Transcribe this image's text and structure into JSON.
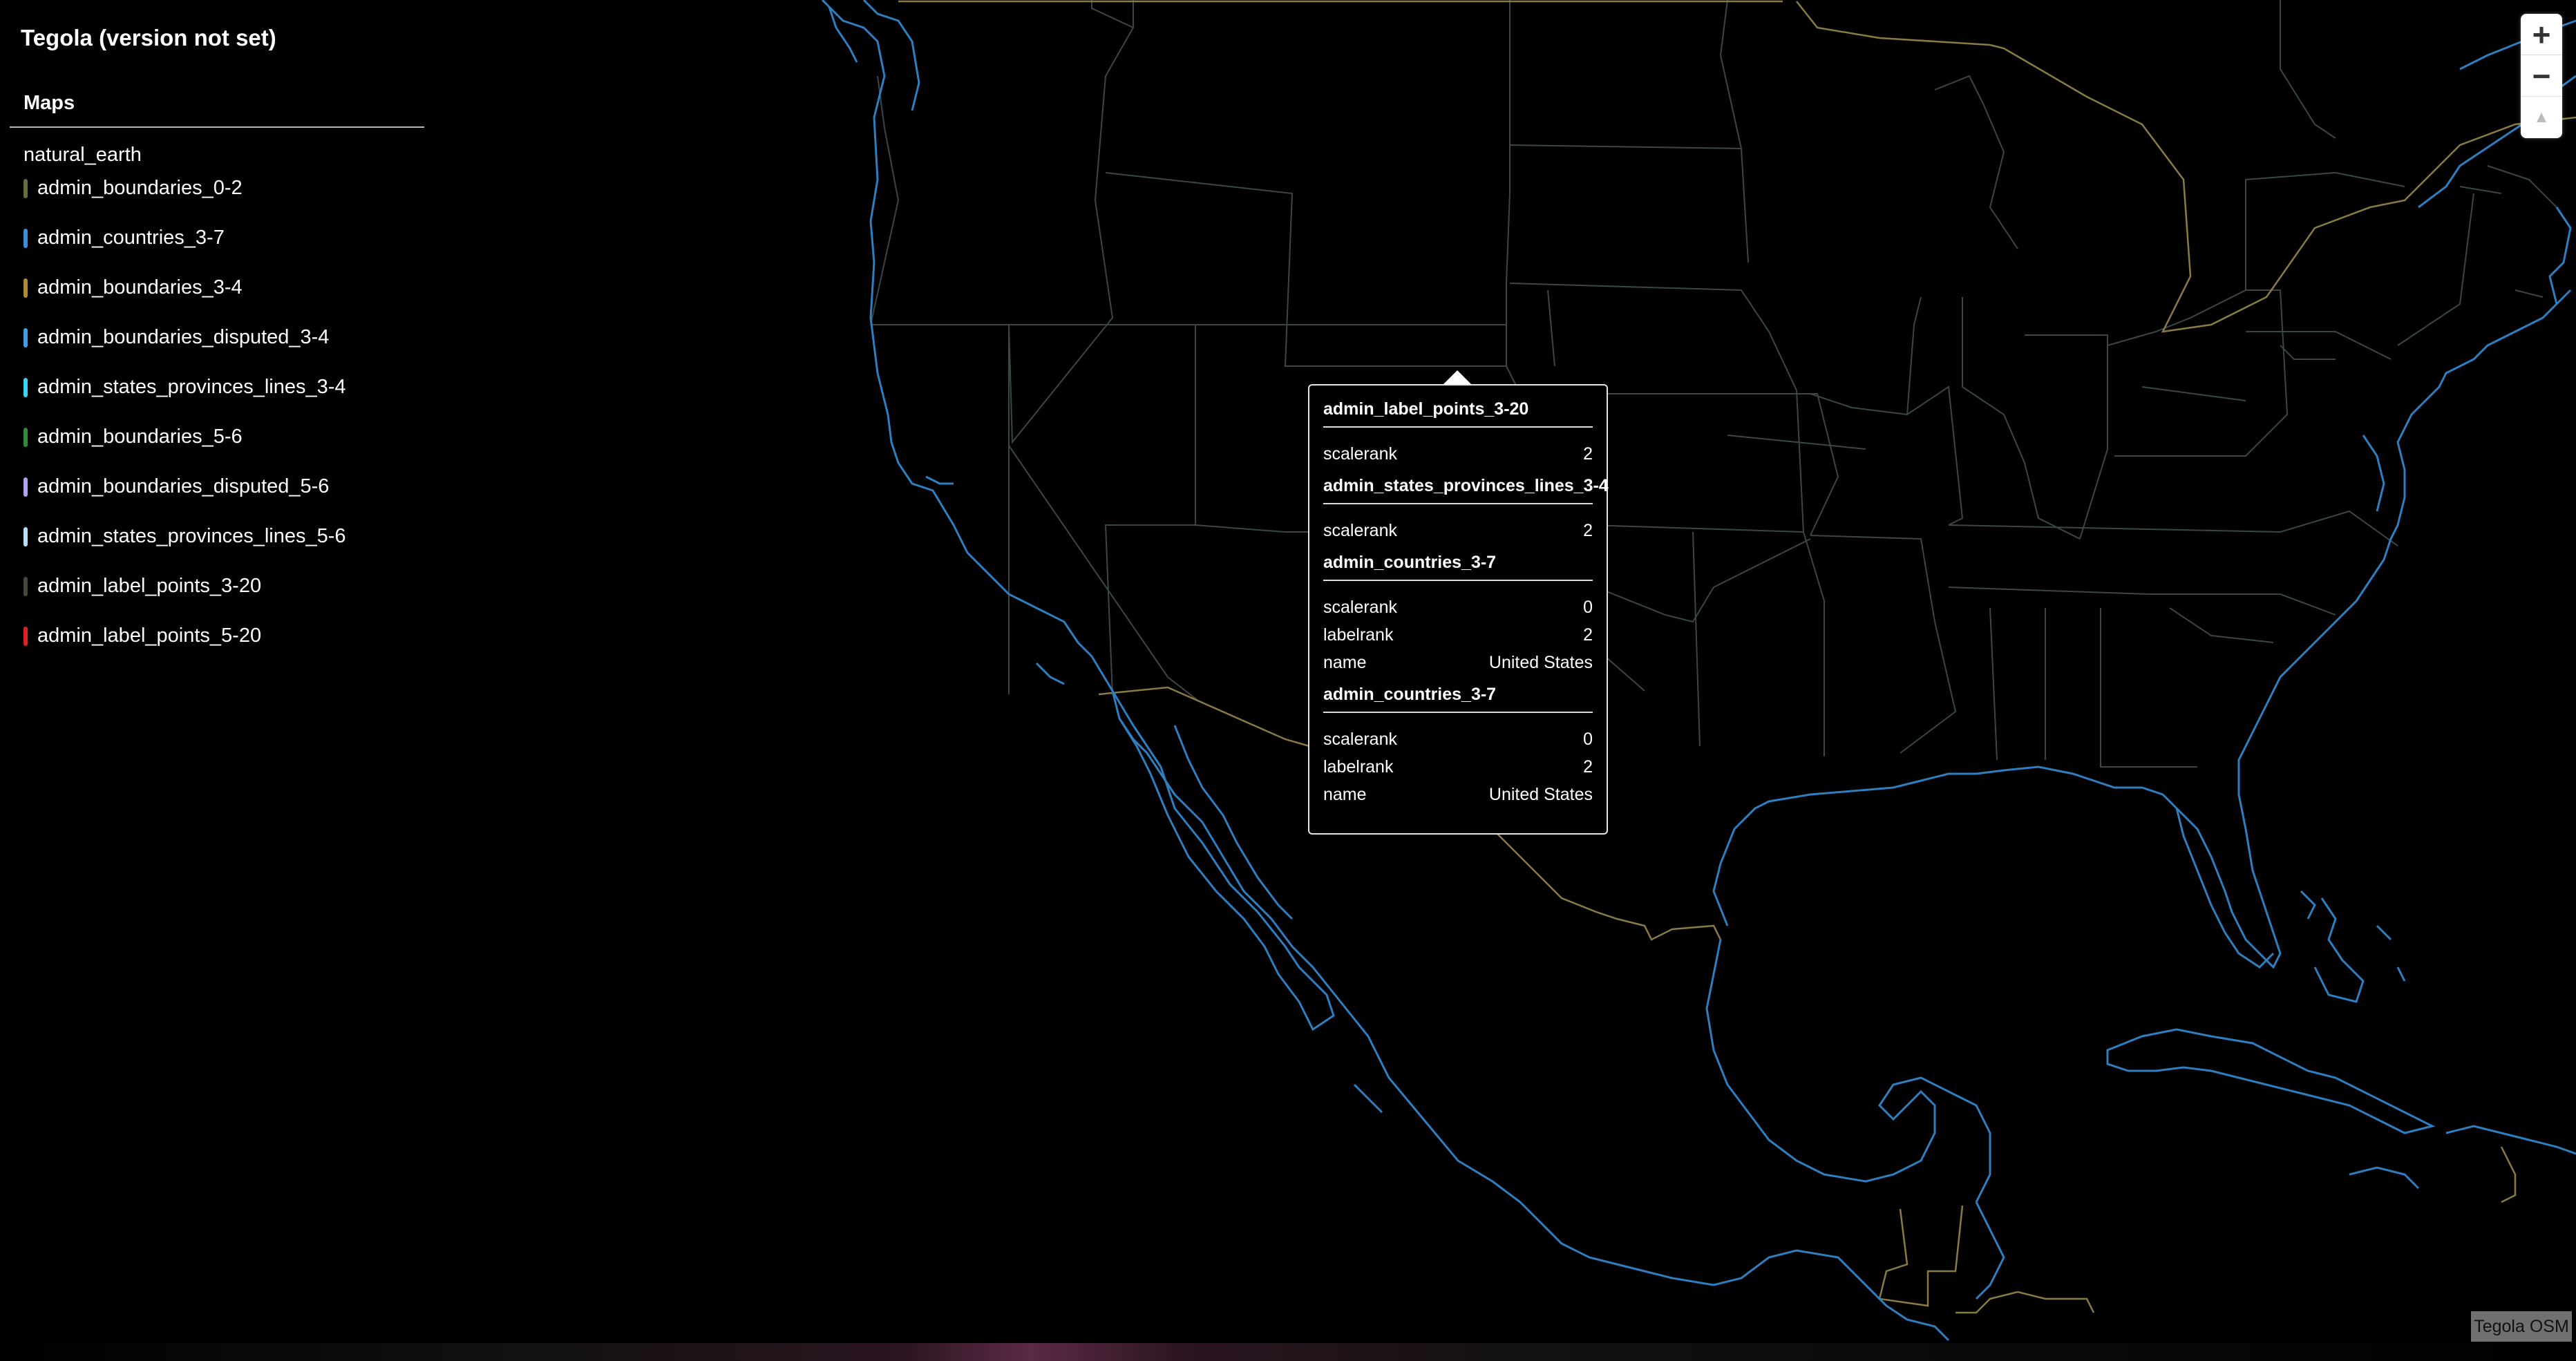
{
  "app": {
    "title": "Tegola (version not set)"
  },
  "sidebar": {
    "maps_heading": "Maps",
    "map_name": "natural_earth",
    "layers": [
      {
        "label": "admin_boundaries_0-2",
        "color": "#6b6b3a"
      },
      {
        "label": "admin_countries_3-7",
        "color": "#3a8fd6"
      },
      {
        "label": "admin_boundaries_3-4",
        "color": "#b08a2e"
      },
      {
        "label": "admin_boundaries_disputed_3-4",
        "color": "#3a9ee8"
      },
      {
        "label": "admin_states_provinces_lines_3-4",
        "color": "#36d4f5"
      },
      {
        "label": "admin_boundaries_5-6",
        "color": "#2e8c3a"
      },
      {
        "label": "admin_boundaries_disputed_5-6",
        "color": "#a8a4ee"
      },
      {
        "label": "admin_states_provinces_lines_5-6",
        "color": "#b6def5"
      },
      {
        "label": "admin_label_points_3-20",
        "color": "#3f4a3a"
      },
      {
        "label": "admin_label_points_5-20",
        "color": "#e02020"
      }
    ]
  },
  "controls": {
    "zoom_in": "+",
    "zoom_out": "−",
    "reset_north": "▲"
  },
  "popup": {
    "sections": [
      {
        "title": "admin_label_points_3-20",
        "rows": [
          {
            "key": "scalerank",
            "value": "2"
          }
        ]
      },
      {
        "title": "admin_states_provinces_lines_3-4",
        "rows": [
          {
            "key": "scalerank",
            "value": "2"
          }
        ]
      },
      {
        "title": "admin_countries_3-7",
        "rows": [
          {
            "key": "scalerank",
            "value": "0"
          },
          {
            "key": "labelrank",
            "value": "2"
          },
          {
            "key": "name",
            "value": "United States"
          }
        ]
      },
      {
        "title": "admin_countries_3-7",
        "rows": [
          {
            "key": "scalerank",
            "value": "0"
          },
          {
            "key": "labelrank",
            "value": "2"
          },
          {
            "key": "name",
            "value": "United States"
          }
        ]
      }
    ]
  },
  "attribution": "Tegola OSM",
  "colors": {
    "background": "#000000",
    "coastline": "#2f7fc0",
    "state_lines": "#3a4a4a",
    "country_border": "#8a7a4a"
  }
}
